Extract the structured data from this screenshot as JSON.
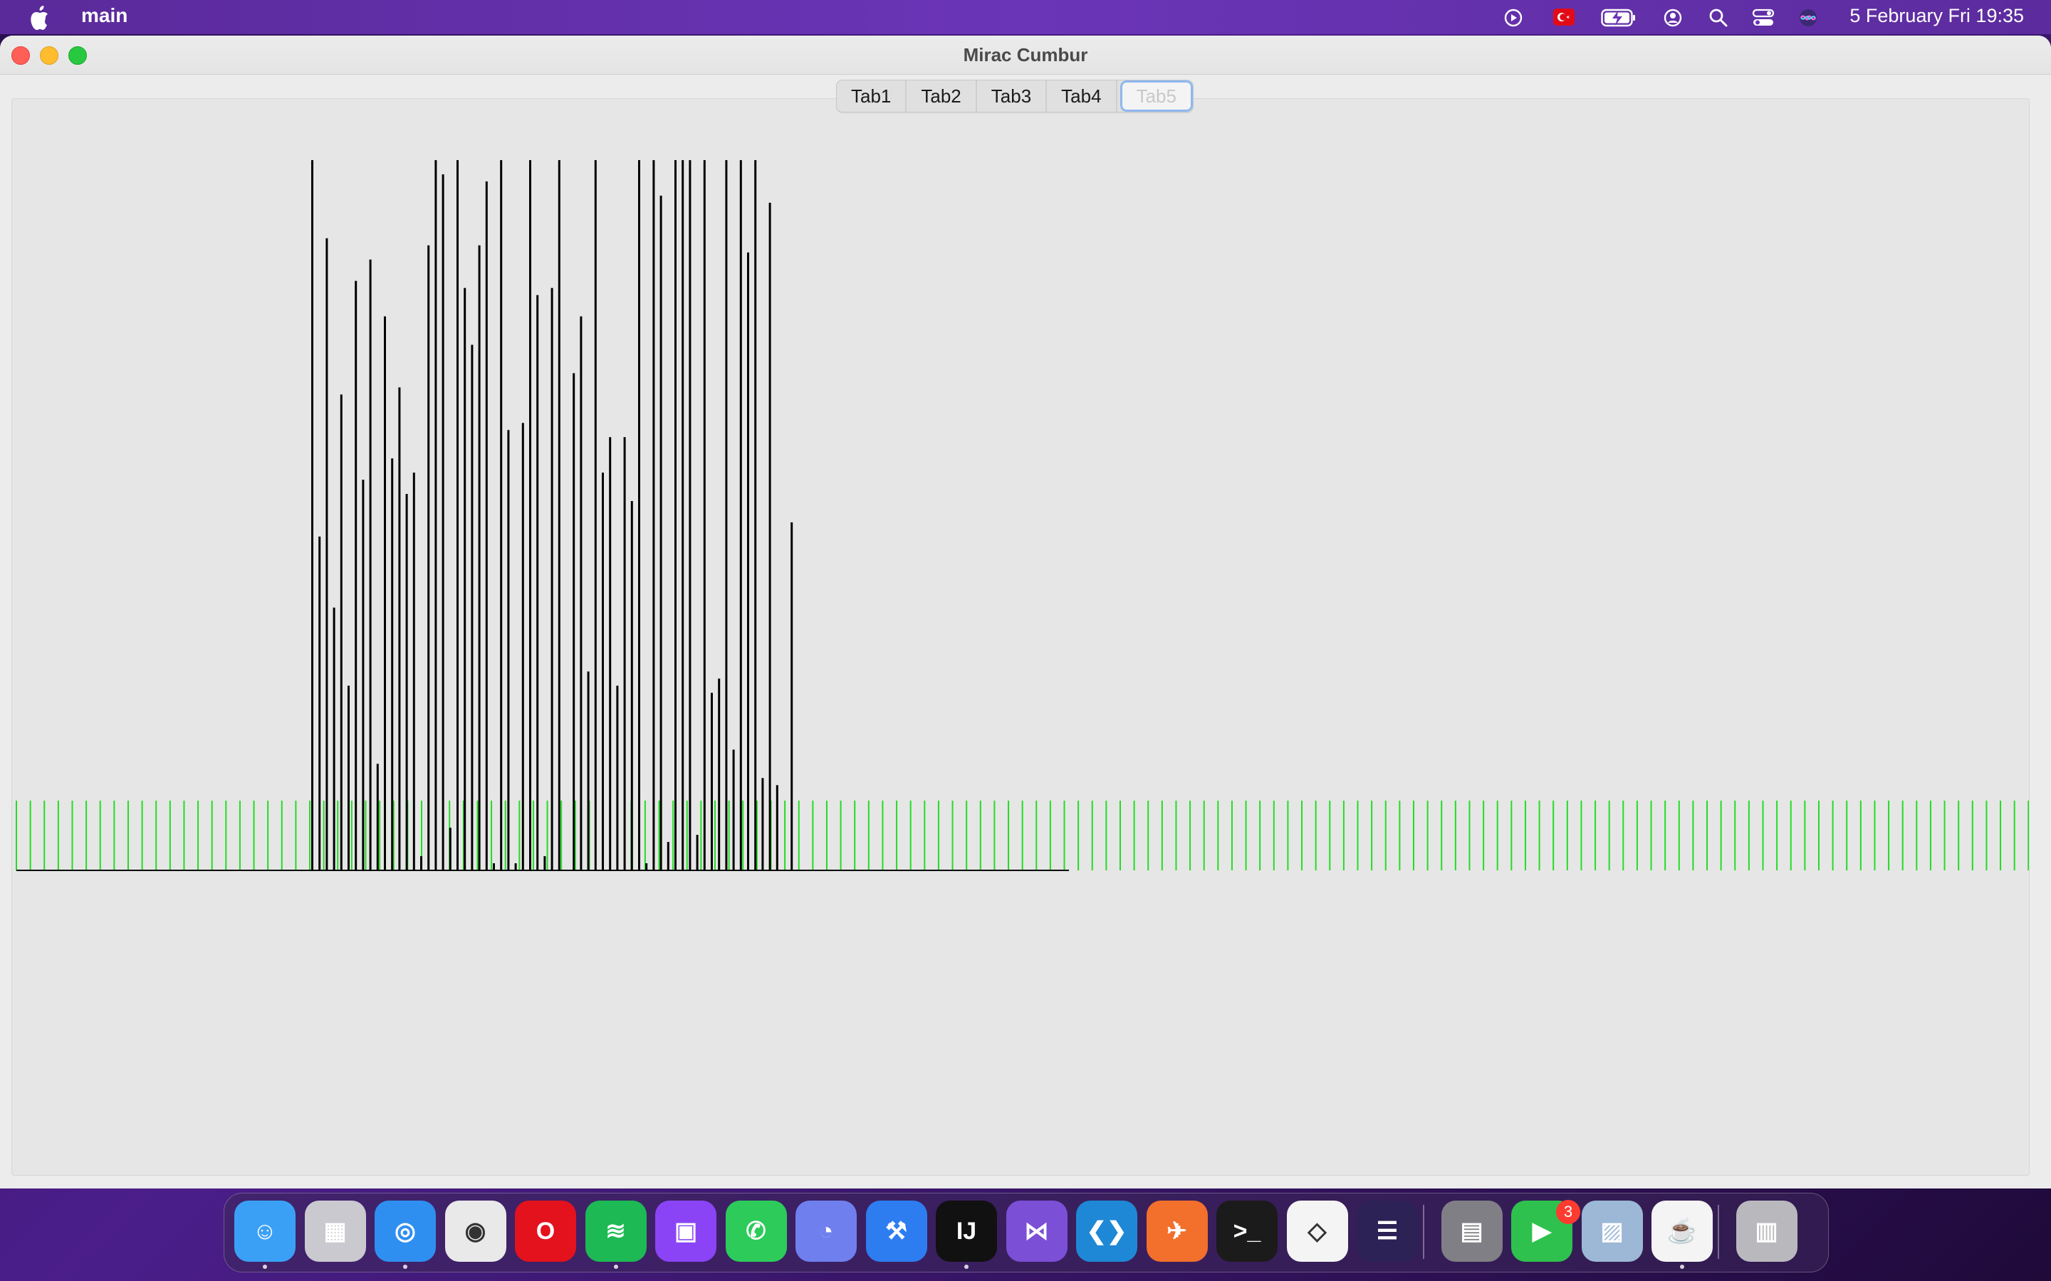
{
  "menubar": {
    "app_name": "main",
    "clock": "5 February Fri  19:35",
    "status_icons": [
      "play-circle-icon",
      "turkey-flag-icon",
      "battery-charging-icon",
      "user-circle-icon",
      "search-icon",
      "control-center-icon",
      "siri-icon"
    ]
  },
  "window": {
    "title": "Mirac Cumbur",
    "tabs": [
      {
        "label": "Tab1",
        "active": false
      },
      {
        "label": "Tab2",
        "active": false
      },
      {
        "label": "Tab3",
        "active": false
      },
      {
        "label": "Tab4",
        "active": false
      },
      {
        "label": "Tab5",
        "active": true
      }
    ]
  },
  "colors": {
    "bar": "#000000",
    "grid_tick": "#22dd22",
    "accent_tab_border": "#8fb8ee"
  },
  "dock": {
    "apps": [
      {
        "name": "finder-icon",
        "color": "#3aa0f5",
        "glyph": "☺",
        "running": true
      },
      {
        "name": "launchpad-icon",
        "color": "#c9c9cf",
        "glyph": "▦",
        "running": false
      },
      {
        "name": "safari-icon",
        "color": "#2f8ff0",
        "glyph": "◎",
        "running": true
      },
      {
        "name": "chrome-icon",
        "color": "#e9e9e9",
        "glyph": "◉",
        "running": false
      },
      {
        "name": "opera-icon",
        "color": "#e3121d",
        "glyph": "O",
        "running": false
      },
      {
        "name": "spotify-icon",
        "color": "#1db954",
        "glyph": "≋",
        "running": true
      },
      {
        "name": "twitch-icon",
        "color": "#8a44f5",
        "glyph": "▣",
        "running": false
      },
      {
        "name": "whatsapp-icon",
        "color": "#2ccb5a",
        "glyph": "✆",
        "running": false
      },
      {
        "name": "discord-icon",
        "color": "#6f7fee",
        "glyph": "◔",
        "running": false
      },
      {
        "name": "xcode-icon",
        "color": "#2d7df0",
        "glyph": "⚒",
        "running": false
      },
      {
        "name": "intellij-icon",
        "color": "#111111",
        "glyph": "IJ",
        "running": true
      },
      {
        "name": "visual-studio-icon",
        "color": "#7b4fd6",
        "glyph": "⋈",
        "running": false
      },
      {
        "name": "vscode-icon",
        "color": "#1e88d6",
        "glyph": "❮❯",
        "running": false
      },
      {
        "name": "postman-icon",
        "color": "#f36f2c",
        "glyph": "✈",
        "running": false
      },
      {
        "name": "terminal-icon",
        "color": "#1b1b1b",
        "glyph": ">_",
        "running": false
      },
      {
        "name": "unity-icon",
        "color": "#f4f4f4",
        "glyph": "◇",
        "running": false
      },
      {
        "name": "eclipse-icon",
        "color": "#2c2255",
        "glyph": "☰",
        "running": false
      },
      {
        "name": "calculator-icon",
        "color": "#7f7f85",
        "glyph": "▤",
        "running": false
      },
      {
        "name": "facetime-icon",
        "color": "#2fc14d",
        "glyph": "▶",
        "running": false,
        "badge": "3"
      },
      {
        "name": "preview-icon",
        "color": "#9cb8d6",
        "glyph": "▨",
        "running": false
      },
      {
        "name": "java-icon",
        "color": "#f4f4f4",
        "glyph": "☕",
        "running": true
      },
      {
        "name": "trash-icon",
        "color": "#b9b9bd",
        "glyph": "▥",
        "running": false
      }
    ]
  },
  "chart_data": {
    "type": "bar",
    "description_note": "",
    "ylim": [
      0,
      100
    ],
    "x_count": 146,
    "grid": true,
    "values": [
      0,
      0,
      0,
      0,
      0,
      0,
      0,
      0,
      0,
      0,
      0,
      0,
      0,
      0,
      0,
      0,
      0,
      0,
      0,
      0,
      0,
      100,
      47,
      89,
      37,
      67,
      26,
      83,
      55,
      86,
      15,
      78,
      58,
      68,
      53,
      56,
      2,
      88,
      100,
      98,
      6,
      100,
      82,
      74,
      88,
      97,
      1,
      100,
      62,
      1,
      63,
      100,
      81,
      2,
      82,
      100,
      0,
      70,
      78,
      28,
      100,
      56,
      61,
      26,
      61,
      52,
      100,
      1,
      100,
      95,
      4,
      100,
      100,
      100,
      5,
      100,
      25,
      27,
      100,
      17,
      100,
      87,
      100,
      13,
      94,
      12,
      0,
      49,
      0,
      0,
      0,
      0,
      0,
      0,
      0,
      0,
      0,
      0,
      0,
      0,
      0,
      0,
      0,
      0,
      0,
      0,
      0,
      0,
      0,
      0,
      0,
      0,
      0,
      0,
      0,
      0,
      0,
      0,
      0,
      0,
      0,
      0,
      0,
      0,
      0,
      0,
      0,
      0,
      0,
      0,
      0,
      0,
      0,
      0,
      0,
      0,
      0,
      0,
      0,
      0,
      0,
      0,
      0,
      0,
      0,
      0,
      0,
      0
    ]
  }
}
